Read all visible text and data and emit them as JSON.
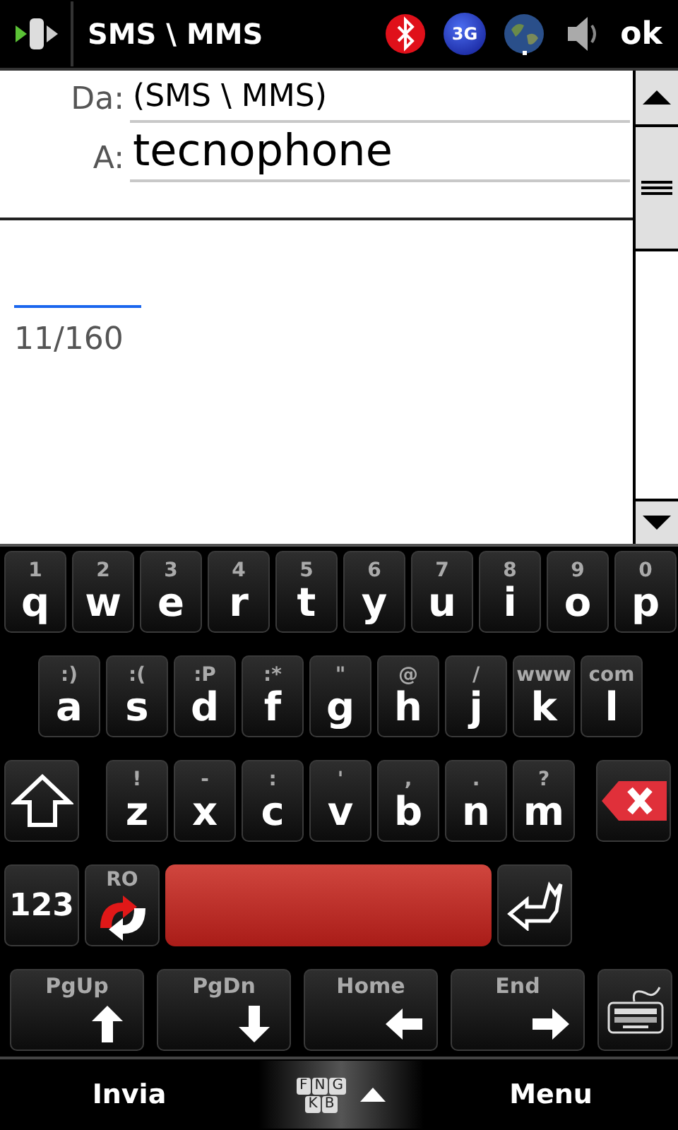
{
  "title_bar": {
    "title": "SMS \\ MMS",
    "network_badge": "3G",
    "ok": "ok"
  },
  "header": {
    "from_label": "Da:",
    "from_value": "(SMS \\ MMS)",
    "to_label": "A:",
    "to_value": "tecnophone"
  },
  "body": {
    "counter": "11/160"
  },
  "keyboard": {
    "rows": [
      [
        {
          "kind": "letter",
          "alt": "1",
          "main": "q"
        },
        {
          "kind": "letter",
          "alt": "2",
          "main": "w"
        },
        {
          "kind": "letter",
          "alt": "3",
          "main": "e"
        },
        {
          "kind": "letter",
          "alt": "4",
          "main": "r"
        },
        {
          "kind": "letter",
          "alt": "5",
          "main": "t"
        },
        {
          "kind": "letter",
          "alt": "6",
          "main": "y"
        },
        {
          "kind": "letter",
          "alt": "7",
          "main": "u"
        },
        {
          "kind": "letter",
          "alt": "8",
          "main": "i"
        },
        {
          "kind": "letter",
          "alt": "9",
          "main": "o"
        },
        {
          "kind": "letter",
          "alt": "0",
          "main": "p"
        }
      ],
      [
        {
          "kind": "letter",
          "alt": ":)",
          "main": "a"
        },
        {
          "kind": "letter",
          "alt": ":(",
          "main": "s"
        },
        {
          "kind": "letter",
          "alt": ":P",
          "main": "d"
        },
        {
          "kind": "letter",
          "alt": ":*",
          "main": "f"
        },
        {
          "kind": "letter",
          "alt": "\"",
          "main": "g"
        },
        {
          "kind": "letter",
          "alt": "@",
          "main": "h"
        },
        {
          "kind": "letter",
          "alt": "/",
          "main": "j"
        },
        {
          "kind": "letter",
          "alt": "www",
          "main": "k"
        },
        {
          "kind": "letter",
          "alt": "com",
          "main": "l"
        }
      ],
      [
        {
          "kind": "shift"
        },
        {
          "kind": "letter",
          "alt": "!",
          "main": "z"
        },
        {
          "kind": "letter",
          "alt": "-",
          "main": "x"
        },
        {
          "kind": "letter",
          "alt": ":",
          "main": "c"
        },
        {
          "kind": "letter",
          "alt": "'",
          "main": "v"
        },
        {
          "kind": "letter",
          "alt": ",",
          "main": "b"
        },
        {
          "kind": "letter",
          "alt": ".",
          "main": "n"
        },
        {
          "kind": "letter",
          "alt": "?",
          "main": "m"
        },
        {
          "kind": "backspace"
        }
      ],
      [
        {
          "kind": "numbers",
          "main": "123"
        },
        {
          "kind": "language",
          "alt": "RO"
        },
        {
          "kind": "space"
        },
        {
          "kind": "enter"
        }
      ]
    ],
    "nav_keys": [
      {
        "kind": "up",
        "label": "PgUp"
      },
      {
        "kind": "down",
        "label": "PgDn"
      },
      {
        "kind": "left",
        "label": "Home"
      },
      {
        "kind": "right",
        "label": "End"
      },
      {
        "kind": "keyboard"
      }
    ]
  },
  "softkeys": {
    "left": "Invia",
    "switcher": [
      [
        "F",
        "N",
        "G"
      ],
      [
        "K",
        "B"
      ]
    ],
    "right": "Menu"
  }
}
